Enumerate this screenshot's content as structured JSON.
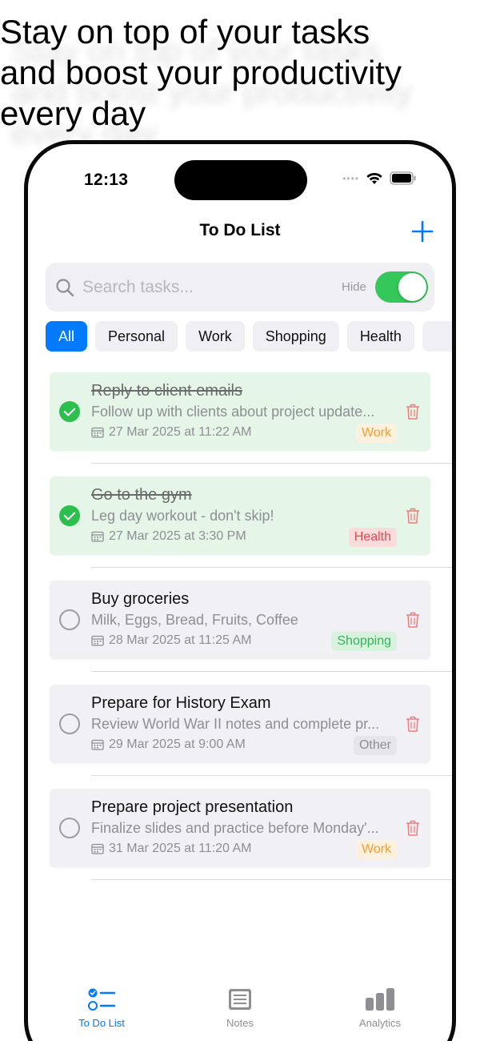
{
  "headline": "Stay on top of your tasks\nand boost your productivity\nevery day",
  "status_bar": {
    "time": "12:13"
  },
  "nav": {
    "title": "To Do List"
  },
  "search": {
    "placeholder": "Search tasks...",
    "value": "",
    "hide_label": "Hide",
    "hide_toggle_on": true
  },
  "filters": {
    "items": [
      "All",
      "Personal",
      "Work",
      "Shopping",
      "Health"
    ],
    "selected": "All"
  },
  "tasks": [
    {
      "title": "Reply to client emails",
      "description": "Follow up with clients about project update...",
      "date": "27 Mar 2025 at 11:22 AM",
      "tag": "Work",
      "completed": true
    },
    {
      "title": "Go to the gym",
      "description": "Leg day workout - don't skip!",
      "date": "27 Mar 2025 at 3:30 PM",
      "tag": "Health",
      "completed": true
    },
    {
      "title": "Buy groceries",
      "description": "Milk, Eggs, Bread, Fruits, Coffee",
      "date": "28 Mar 2025 at 11:25 AM",
      "tag": "Shopping",
      "completed": false
    },
    {
      "title": "Prepare for History Exam",
      "description": "Review World War II notes and complete pr...",
      "date": "29 Mar 2025 at 9:00 AM",
      "tag": "Other",
      "completed": false
    },
    {
      "title": "Prepare project presentation",
      "description": "Finalize slides and practice before Monday'...",
      "date": "31 Mar 2025 at 11:20 AM",
      "tag": "Work",
      "completed": false
    }
  ],
  "tag_colors": {
    "Work": {
      "text": "#f0a03a",
      "bg": "#fdf0dc"
    },
    "Health": {
      "text": "#e5484d",
      "bg": "#f8dcdc"
    },
    "Shopping": {
      "text": "#34b35a",
      "bg": "#d8f2de"
    },
    "Other": {
      "text": "#8e8e93",
      "bg": "#e5e5ea"
    }
  },
  "tabbar": {
    "items": [
      {
        "label": "To Do List",
        "icon": "checklist-icon"
      },
      {
        "label": "Notes",
        "icon": "notes-icon"
      },
      {
        "label": "Analytics",
        "icon": "analytics-icon"
      }
    ],
    "active": "To Do List"
  },
  "colors": {
    "accent": "#007aff",
    "toggle_on": "#34c759",
    "done_bg": "#e5f6e9",
    "done_check": "#2dbf4e",
    "trash": "#f07c7c"
  }
}
